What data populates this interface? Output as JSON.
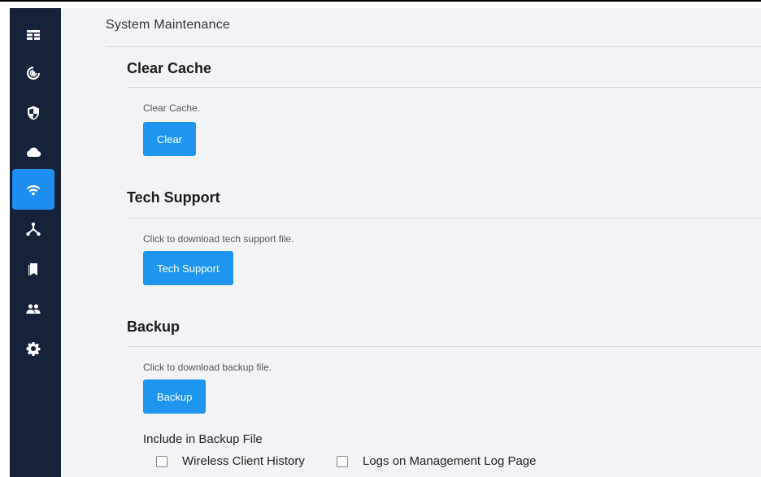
{
  "sidebar": {
    "items": [
      {
        "icon": "dashboard-icon",
        "active": false
      },
      {
        "icon": "radar-icon",
        "active": false
      },
      {
        "icon": "shield-icon",
        "active": false
      },
      {
        "icon": "cloud-icon",
        "active": false
      },
      {
        "icon": "wifi-icon",
        "active": true
      },
      {
        "icon": "network-icon",
        "active": false
      },
      {
        "icon": "bookmark-icon",
        "active": false
      },
      {
        "icon": "users-icon",
        "active": false
      },
      {
        "icon": "gear-icon",
        "active": false
      }
    ],
    "background": "#16213a",
    "active_color": "#1e8ff0"
  },
  "page": {
    "title": "System Maintenance"
  },
  "sections": {
    "clear_cache": {
      "title": "Clear Cache",
      "hint": "Clear Cache.",
      "button": "Clear"
    },
    "tech_support": {
      "title": "Tech Support",
      "hint": "Click to download tech support file.",
      "button": "Tech Support"
    },
    "backup": {
      "title": "Backup",
      "hint": "Click to download backup file.",
      "button": "Backup",
      "include_label": "Include in Backup File",
      "options": [
        {
          "label": "Wireless Client History",
          "checked": false
        },
        {
          "label": "Logs on Management Log Page",
          "checked": false
        }
      ]
    }
  },
  "colors": {
    "button": "#1e95ee",
    "background": "#f2f3f6"
  }
}
